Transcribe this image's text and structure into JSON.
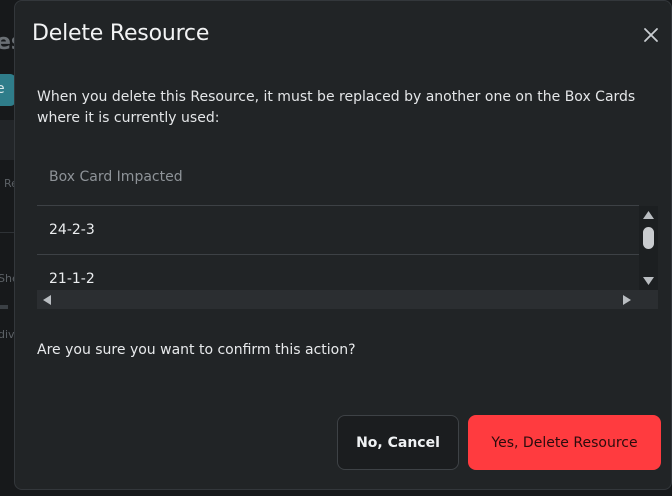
{
  "background": {
    "title_fragment": "es",
    "pill_fragment": "e",
    "label_fragment_1": "Re",
    "label_fragment_2": "She",
    "label_fragment_3": "div"
  },
  "dialog": {
    "title": "Delete Resource",
    "description": "When you delete this Resource, it must be replaced by another one on the Box Cards where it is currently used:",
    "table": {
      "header": "Box Card Impacted",
      "rows": [
        "24-2-3",
        "21-1-2"
      ]
    },
    "confirm_text": "Are you sure you want to confirm this action?",
    "cancel_label": "No, Cancel",
    "delete_label": "Yes, Delete Resource"
  },
  "colors": {
    "danger": "#ff3b3f",
    "dialog_bg": "#212426"
  },
  "icons": {
    "close": "close-icon",
    "scroll_up": "triangle-up-icon",
    "scroll_down": "triangle-down-icon",
    "scroll_left": "triangle-left-icon",
    "scroll_right": "triangle-right-icon"
  }
}
